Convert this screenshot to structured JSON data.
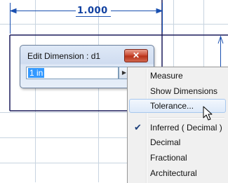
{
  "dimension": {
    "value_text": "1.000"
  },
  "dialog": {
    "title": "Edit Dimension : d1",
    "close_label": "✕",
    "input_value": "1 in",
    "dropdown_icon": "chevron-right-icon"
  },
  "menu": {
    "items": [
      {
        "label": "Measure"
      },
      {
        "label": "Show Dimensions"
      },
      {
        "label": "Tolerance...",
        "hovered": true
      },
      {
        "label": "Inferred ( Decimal )",
        "checked": true
      },
      {
        "label": "Decimal"
      },
      {
        "label": "Fractional"
      },
      {
        "label": "Architectural"
      }
    ]
  },
  "colors": {
    "dimension_line": "#1a50b0",
    "sketch_line": "#1a1a5a",
    "grid": "#c8d4e0",
    "selection": "#3399ff",
    "menu_hover_border": "#a8c8ee",
    "close_button": "#c8442c"
  }
}
